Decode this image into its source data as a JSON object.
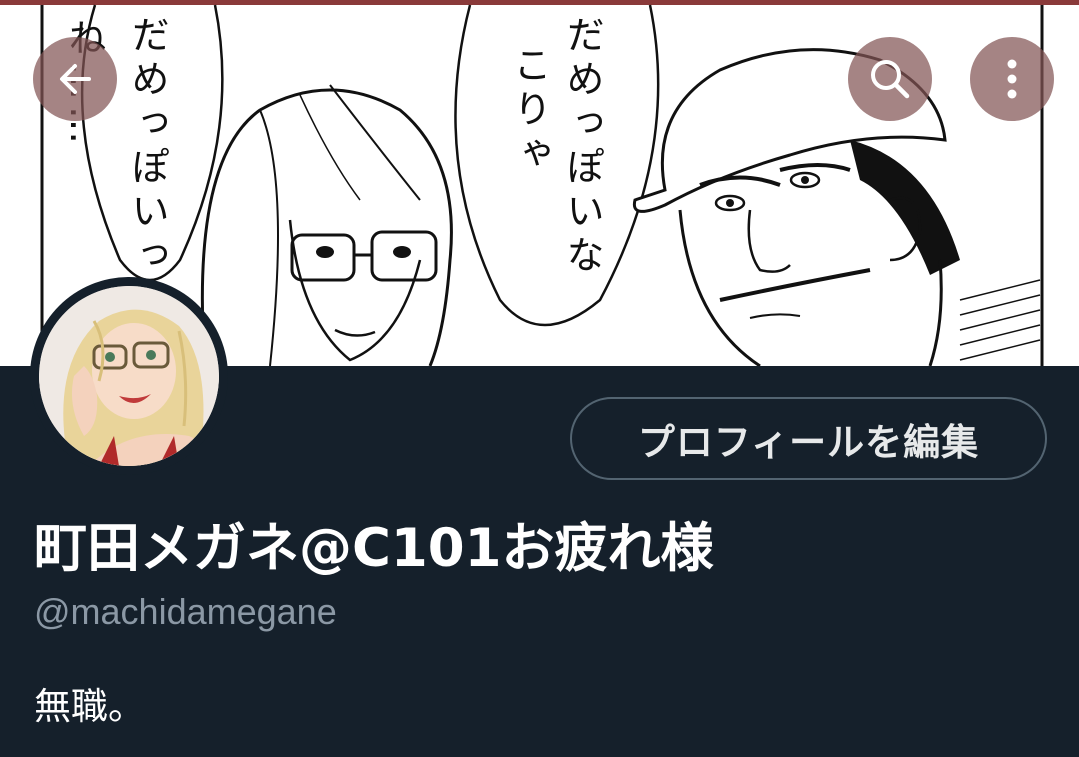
{
  "banner": {
    "speech_left_col1": "ね……",
    "speech_left_col2": "だめっぽいっ",
    "speech_right_col1": "こりゃ",
    "speech_right_col2": "だめっぽいな"
  },
  "topbar": {
    "back_icon": "arrow-left-icon",
    "search_icon": "search-icon",
    "more_icon": "more-vertical-icon"
  },
  "profile": {
    "edit_button_label": "プロフィールを編集",
    "display_name": "町田メガネ@C101お疲れ様",
    "handle": "@machidamegane",
    "bio": "無職。"
  },
  "colors": {
    "background": "#15202b",
    "button_overlay": "#825555",
    "handle_gray": "#8b98a5"
  }
}
